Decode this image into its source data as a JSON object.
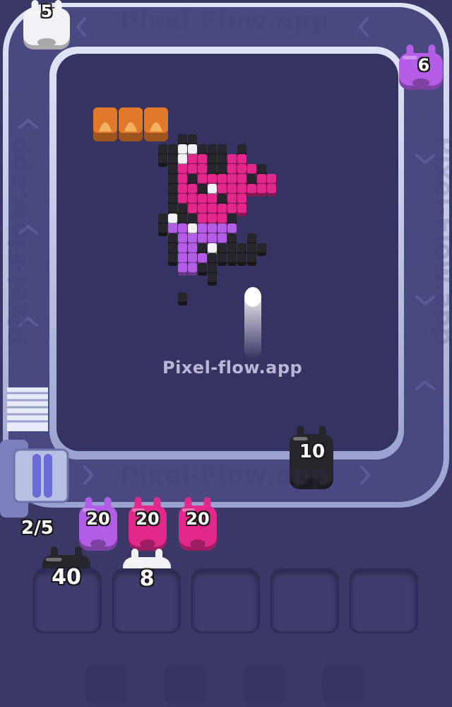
{
  "conveyor": {
    "watermark_top": "Pixel-Flow.app",
    "watermark_bottom": "Pixel-Flow.app",
    "watermark_left": "Pixel-Flow.app",
    "watermark_right": "Pixel-Flow.app"
  },
  "board": {
    "watermark": "Pixel-flow.app"
  },
  "shooters_on_track": [
    {
      "name": "white",
      "ammo": "5",
      "color": "#f2f2f6"
    },
    {
      "name": "purple",
      "ammo": "6",
      "color": "#b45ee8"
    },
    {
      "name": "black",
      "ammo": "10",
      "color": "#26262c"
    }
  ],
  "queue": {
    "counter": "2/5",
    "pigs": [
      {
        "ammo": "20",
        "color": "#b25de6"
      },
      {
        "ammo": "20",
        "color": "#e2288a"
      },
      {
        "ammo": "20",
        "color": "#e2288a"
      }
    ]
  },
  "slots": [
    {
      "ammo": "40",
      "color": "#26262c"
    },
    {
      "ammo": "8",
      "color": "#f2f2f6"
    },
    {
      "ammo": "",
      "color": ""
    },
    {
      "ammo": "",
      "color": ""
    },
    {
      "ammo": "",
      "color": ""
    }
  ],
  "colors": {
    "background": "#3a3866",
    "track": "#c2cae8",
    "pink": "#e2288a",
    "purple": "#b45ee8",
    "black": "#26262c",
    "white": "#f2f2f6",
    "crate": "#e07a2a"
  }
}
